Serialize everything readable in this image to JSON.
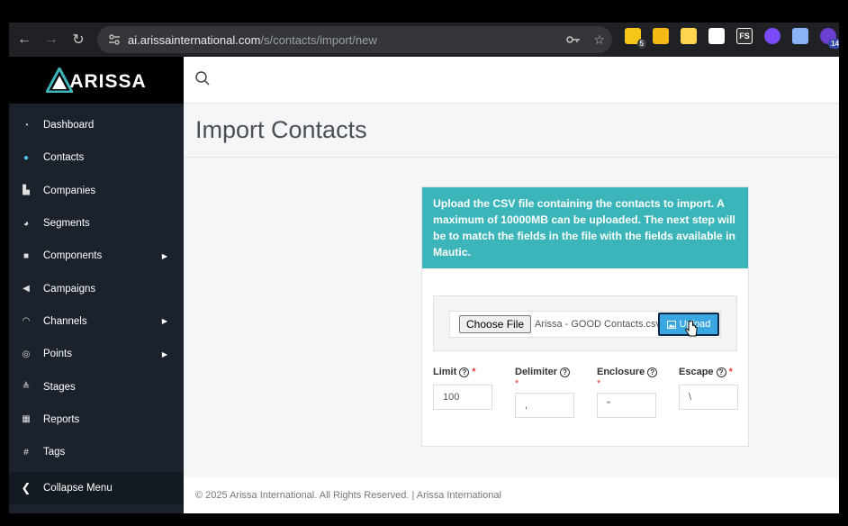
{
  "browser": {
    "url_domain": "ai.arissainternational.com",
    "url_path": "/s/contacts/import/new",
    "extensions": [
      {
        "name": "sticky-notes-extension",
        "color": "#f5c518",
        "badge": "5"
      },
      {
        "name": "notes-extension",
        "color": "#f5b915",
        "badge": ""
      },
      {
        "name": "highlighter-extension",
        "color": "#ffd54f",
        "badge": ""
      },
      {
        "name": "docs-extension",
        "color": "#ffffff",
        "badge": ""
      },
      {
        "name": "fs-extension",
        "color": "#333333",
        "label": "FS",
        "badge": ""
      },
      {
        "name": "purple-extension",
        "color": "#7b4bff",
        "badge": ""
      },
      {
        "name": "copy-extension",
        "color": "#8ab4f8",
        "badge": ""
      },
      {
        "name": "profile-extension",
        "color": "#6c3fd1",
        "badge": "14"
      }
    ]
  },
  "brand": {
    "name": "ARISSA",
    "accent": "#3bb5b9"
  },
  "sidebar": {
    "items": [
      {
        "label": "Dashboard",
        "icon": "dashboard-icon",
        "glyph": "◔",
        "caret": false
      },
      {
        "label": "Contacts",
        "icon": "user-icon",
        "glyph": "●",
        "caret": false
      },
      {
        "label": "Companies",
        "icon": "building-icon",
        "glyph": "▙",
        "caret": false
      },
      {
        "label": "Segments",
        "icon": "pie-chart-icon",
        "glyph": "◕",
        "caret": false
      },
      {
        "label": "Components",
        "icon": "puzzle-icon",
        "glyph": "■",
        "caret": true
      },
      {
        "label": "Campaigns",
        "icon": "megaphone-icon",
        "glyph": "◀",
        "caret": false
      },
      {
        "label": "Channels",
        "icon": "rss-icon",
        "glyph": "◠",
        "caret": true
      },
      {
        "label": "Points",
        "icon": "target-icon",
        "glyph": "◎",
        "caret": true
      },
      {
        "label": "Stages",
        "icon": "stages-icon",
        "glyph": "≜",
        "caret": false
      },
      {
        "label": "Reports",
        "icon": "report-icon",
        "glyph": "▦",
        "caret": false
      },
      {
        "label": "Tags",
        "icon": "hashtag-icon",
        "glyph": "#",
        "caret": false
      }
    ],
    "collapse_label": "Collapse Menu"
  },
  "page": {
    "title": "Import Contacts",
    "info_text": "Upload the CSV file containing the contacts to import. A maximum of 10000MB can be uploaded. The next step will be to match the fields in the file with the fields available in Mautic.",
    "choose_file_label": "Choose File",
    "file_name": "Arissa  - GOOD Contacts.csv",
    "upload_label": "Upload",
    "fields": {
      "limit": {
        "label": "Limit",
        "value": "100",
        "required": "*"
      },
      "delimiter": {
        "label": "Delimiter",
        "value": ",",
        "required": "*"
      },
      "enclosure": {
        "label": "Enclosure",
        "value": "\"",
        "required": "*"
      },
      "escape": {
        "label": "Escape",
        "value": "\\",
        "required": "*"
      }
    },
    "footer": "© 2025 Arissa International. All Rights Reserved. | Arissa International"
  }
}
